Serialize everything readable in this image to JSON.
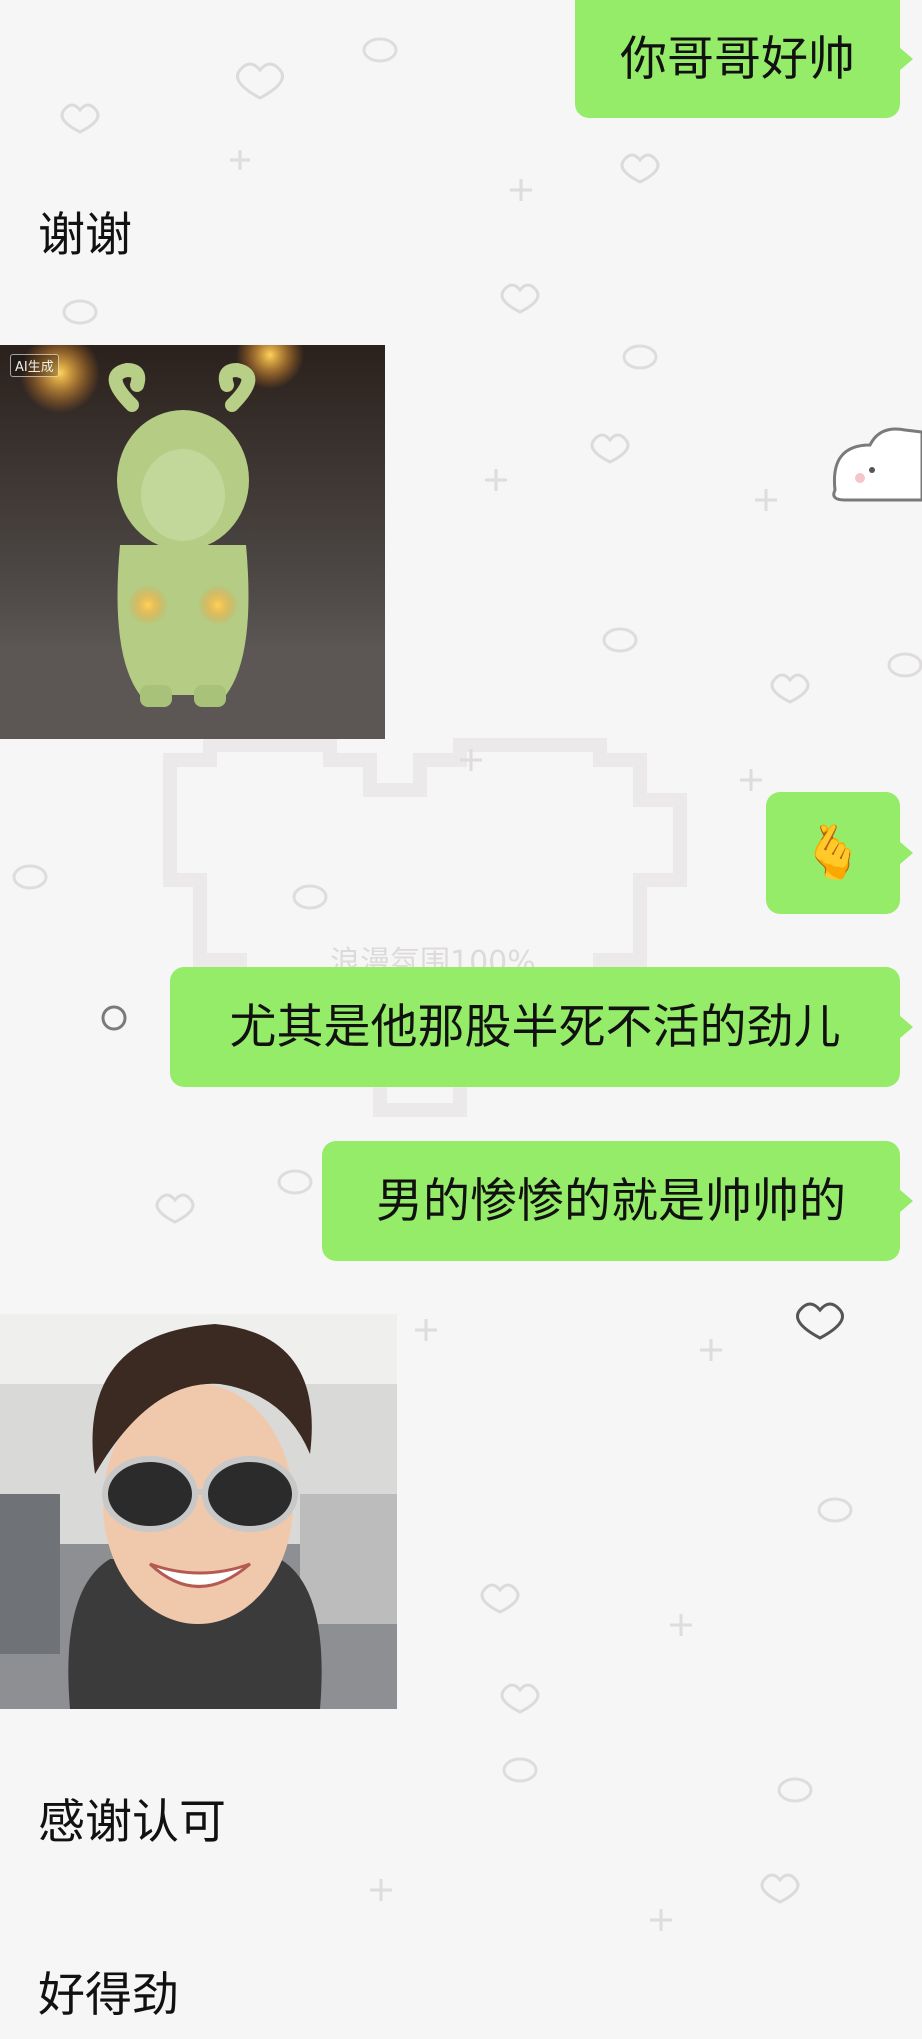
{
  "messages": [
    {
      "side": "right",
      "type": "text",
      "text": "你哥哥好帅"
    },
    {
      "side": "left",
      "type": "text",
      "text": "谢谢"
    },
    {
      "side": "left",
      "type": "image",
      "subject": "green-horned-figurine",
      "badge": "AI生成"
    },
    {
      "side": "right",
      "type": "emoji",
      "text": "🫰"
    },
    {
      "side": "right",
      "type": "text",
      "text": "尤其是他那股半死不活的劲儿"
    },
    {
      "side": "right",
      "type": "text",
      "text": "男的惨惨的就是帅帅的"
    },
    {
      "side": "left",
      "type": "image",
      "subject": "smiling-man-sunglasses-selfie"
    },
    {
      "side": "left",
      "type": "text",
      "text": "感谢认可"
    },
    {
      "side": "left",
      "type": "text",
      "text": "好得劲"
    }
  ],
  "wallpaper": {
    "watermark_text": "浪漫氛围100%"
  },
  "colors": {
    "bubble_sent": "#95ec69",
    "background": "#f7f6f6",
    "text": "#111111"
  }
}
